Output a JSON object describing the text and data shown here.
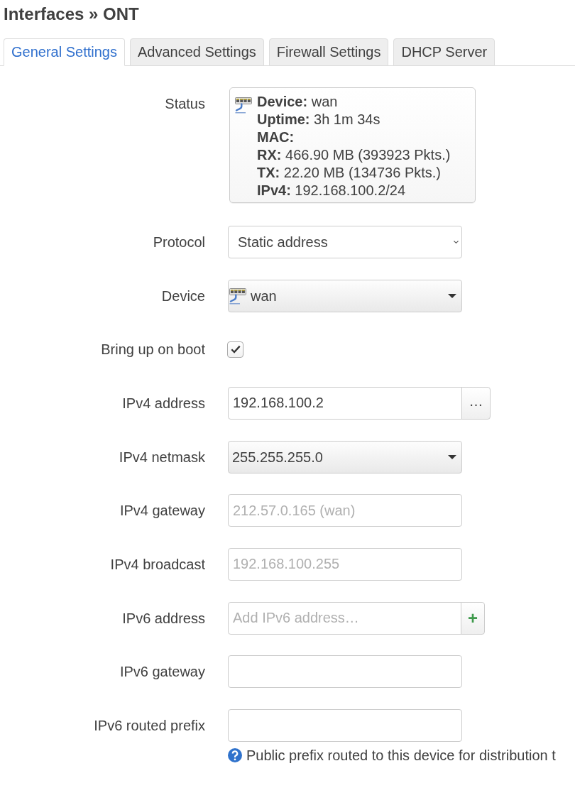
{
  "title": "Interfaces » ONT",
  "tabs": [
    {
      "label": "General Settings",
      "selected": true
    },
    {
      "label": "Advanced Settings",
      "selected": false
    },
    {
      "label": "Firewall Settings",
      "selected": false
    },
    {
      "label": "DHCP Server",
      "selected": false
    }
  ],
  "fields": [
    {
      "kind": "status",
      "label": "Status",
      "lines": [
        {
          "label": "Device:",
          "value": "wan"
        },
        {
          "label": "Uptime:",
          "value": "3h 1m 34s"
        },
        {
          "label": "MAC:"
        },
        {
          "label": "RX:",
          "value": "466.90 MB (393923 Pkts.)"
        },
        {
          "label": "TX:",
          "value": "22.20 MB (134736 Pkts.)"
        },
        {
          "label": "IPv4:",
          "value": "192.168.100.2/24"
        }
      ]
    },
    {
      "kind": "select",
      "label": "Protocol",
      "value": "Static address"
    },
    {
      "kind": "device",
      "label": "Device",
      "value": "wan"
    },
    {
      "kind": "checkbox",
      "label": "Bring up on boot",
      "checked": true
    },
    {
      "kind": "text",
      "label": "IPv4 address",
      "value": "192.168.100.2",
      "button": {
        "kind": "more",
        "label": "…"
      }
    },
    {
      "kind": "dropdown",
      "label": "IPv4 netmask",
      "value": "255.255.255.0"
    },
    {
      "kind": "text",
      "label": "IPv4 gateway",
      "placeholder": "212.57.0.165 (wan)"
    },
    {
      "kind": "text",
      "label": "IPv4 broadcast",
      "placeholder": "192.168.100.255"
    },
    {
      "kind": "text",
      "label": "IPv6 address",
      "placeholder": "Add IPv6 address…",
      "button": {
        "kind": "add",
        "label": "+"
      }
    },
    {
      "kind": "text",
      "label": "IPv6 gateway"
    },
    {
      "kind": "text",
      "label": "IPv6 routed prefix",
      "help": "Public prefix routed to this device for distribution t"
    }
  ]
}
